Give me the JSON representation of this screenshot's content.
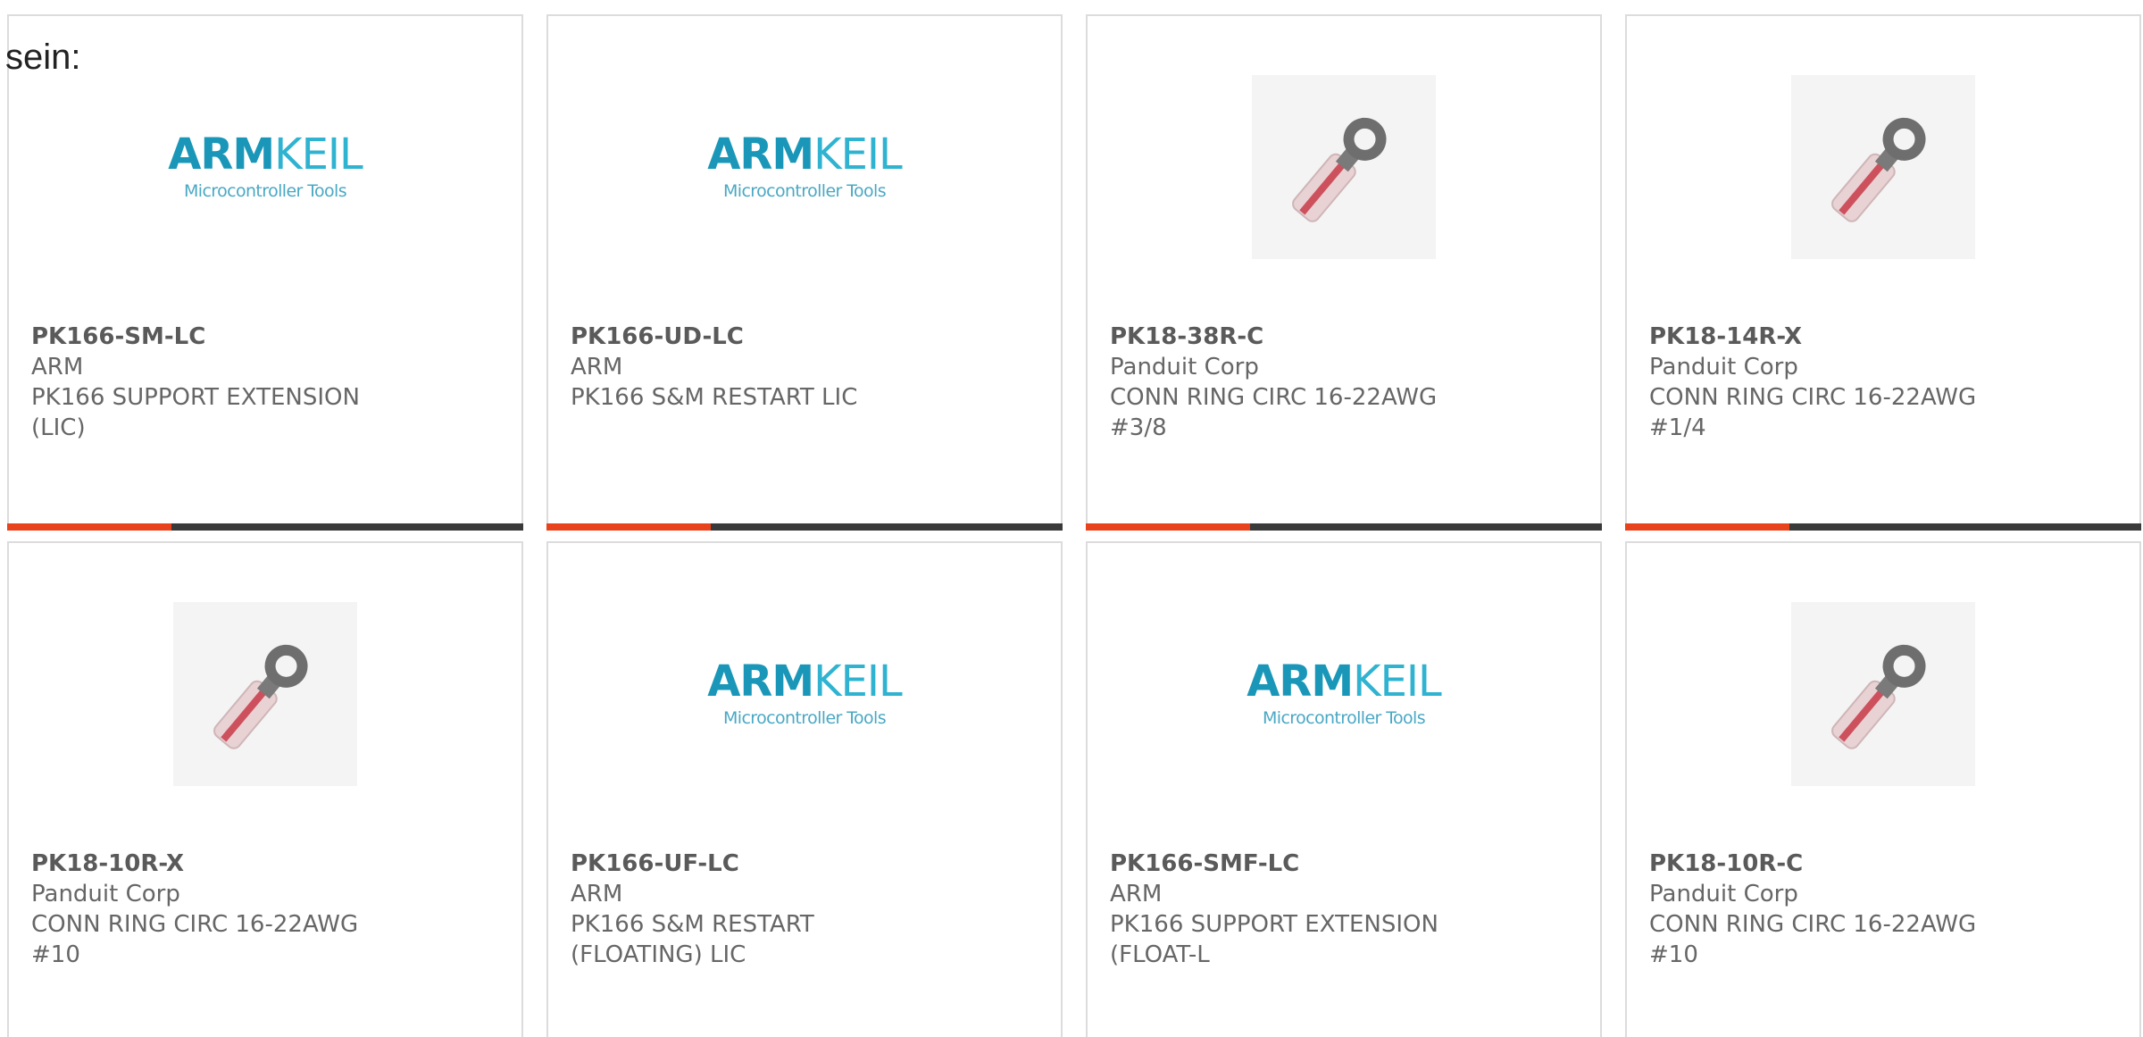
{
  "header": {
    "text": "sein:"
  },
  "cards": [
    {
      "part": "PK166-SM-LC",
      "maker": "ARM",
      "desc": "PK166 SUPPORT EXTENSION (LIC)",
      "image": "arm-keil-logo"
    },
    {
      "part": "PK166-UD-LC",
      "maker": "ARM",
      "desc": "PK166 S&M RESTART LIC",
      "image": "arm-keil-logo"
    },
    {
      "part": "PK18-38R-C",
      "maker": "Panduit Corp",
      "desc": "CONN RING CIRC 16-22AWG #3/8",
      "image": "ring-terminal-photo"
    },
    {
      "part": "PK18-14R-X",
      "maker": "Panduit Corp",
      "desc": "CONN RING CIRC 16-22AWG #1/4",
      "image": "ring-terminal-photo"
    },
    {
      "part": "PK18-10R-X",
      "maker": "Panduit Corp",
      "desc": "CONN RING CIRC 16-22AWG #10",
      "image": "ring-terminal-photo"
    },
    {
      "part": "PK166-UF-LC",
      "maker": "ARM",
      "desc": "PK166 S&M RESTART (FLOATING) LIC",
      "image": "arm-keil-logo"
    },
    {
      "part": "PK166-SMF-LC",
      "maker": "ARM",
      "desc": "PK166 SUPPORT EXTENSION (FLOAT-L",
      "image": "arm-keil-logo"
    },
    {
      "part": "PK18-10R-C",
      "maker": "Panduit Corp",
      "desc": "CONN RING CIRC 16-22AWG #10",
      "image": "ring-terminal-photo"
    }
  ],
  "logo": {
    "brand_bold": "ARM",
    "brand_light": "KEIL",
    "tagline": "Microcontroller Tools"
  },
  "colors": {
    "accent": "#e8431c",
    "bar_dark": "#3a3a3a",
    "logo_blue": "#1a97b8",
    "border": "#dcdcdc",
    "text": "#666666"
  }
}
